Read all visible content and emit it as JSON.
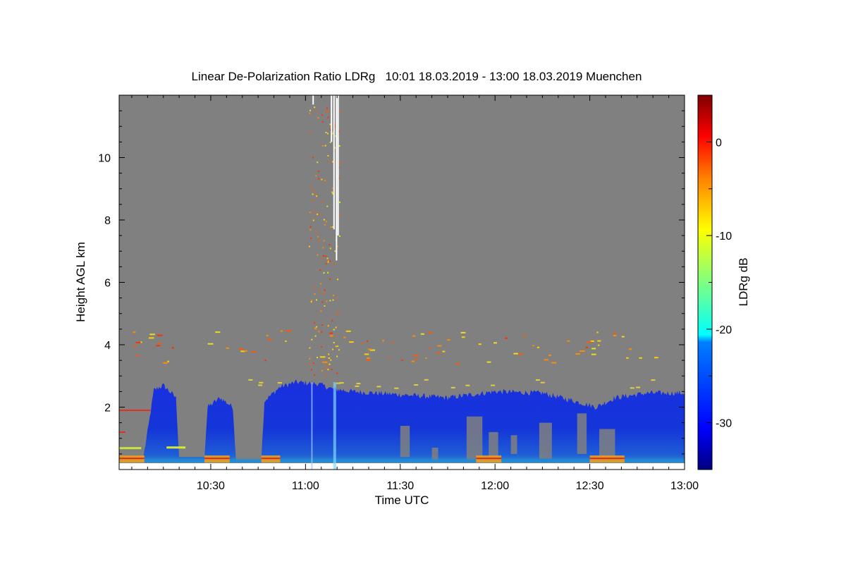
{
  "chart_data": {
    "type": "heatmap",
    "title": "Linear De-Polarization Ratio LDRg   10:01 18.03.2019 - 13:00 18.03.2019 Muenchen",
    "xlabel": "Time UTC",
    "ylabel": "Height AGL km",
    "colorbar_label": "LDRg dB",
    "x_start_min": 601,
    "x_end_min": 780,
    "x_ticks": [
      {
        "min": 630,
        "label": "10:30"
      },
      {
        "min": 660,
        "label": "11:00"
      },
      {
        "min": 690,
        "label": "11:30"
      },
      {
        "min": 720,
        "label": "12:00"
      },
      {
        "min": 750,
        "label": "12:30"
      },
      {
        "min": 780,
        "label": "13:00"
      }
    ],
    "ylim": [
      0,
      12
    ],
    "y_ticks": [
      {
        "v": 2,
        "label": "2"
      },
      {
        "v": 4,
        "label": "4"
      },
      {
        "v": 6,
        "label": "6"
      },
      {
        "v": 8,
        "label": "8"
      },
      {
        "v": 10,
        "label": "10"
      }
    ],
    "clim": [
      -35,
      5
    ],
    "c_ticks": [
      {
        "v": 0,
        "label": "0"
      },
      {
        "v": -10,
        "label": "-10"
      },
      {
        "v": -20,
        "label": "-20"
      },
      {
        "v": -30,
        "label": "-30"
      }
    ],
    "colormap": [
      "#00007f",
      "#0000ff",
      "#007fff",
      "#00ffff",
      "#7fff7f",
      "#ffff00",
      "#ff7f00",
      "#ff0000",
      "#7f0000"
    ],
    "background_color": "#808080",
    "cloud_top_km": [
      {
        "t": 608,
        "h": 0.0
      },
      {
        "t": 610,
        "h": 1.2
      },
      {
        "t": 612,
        "h": 2.55
      },
      {
        "t": 615,
        "h": 2.7
      },
      {
        "t": 619,
        "h": 2.3
      },
      {
        "t": 620,
        "h": 0.4
      },
      {
        "t": 628,
        "h": 0.4
      },
      {
        "t": 629,
        "h": 2.0
      },
      {
        "t": 633,
        "h": 2.3
      },
      {
        "t": 637,
        "h": 2.0
      },
      {
        "t": 638,
        "h": 0.3
      },
      {
        "t": 646,
        "h": 0.3
      },
      {
        "t": 647,
        "h": 2.2
      },
      {
        "t": 652,
        "h": 2.65
      },
      {
        "t": 657,
        "h": 2.8
      },
      {
        "t": 664,
        "h": 2.75
      },
      {
        "t": 668,
        "h": 2.6
      },
      {
        "t": 675,
        "h": 2.5
      },
      {
        "t": 690,
        "h": 2.4
      },
      {
        "t": 705,
        "h": 2.3
      },
      {
        "t": 720,
        "h": 2.5
      },
      {
        "t": 735,
        "h": 2.45
      },
      {
        "t": 745,
        "h": 2.2
      },
      {
        "t": 752,
        "h": 2.0
      },
      {
        "t": 758,
        "h": 2.3
      },
      {
        "t": 768,
        "h": 2.45
      },
      {
        "t": 780,
        "h": 2.45
      }
    ]
  }
}
